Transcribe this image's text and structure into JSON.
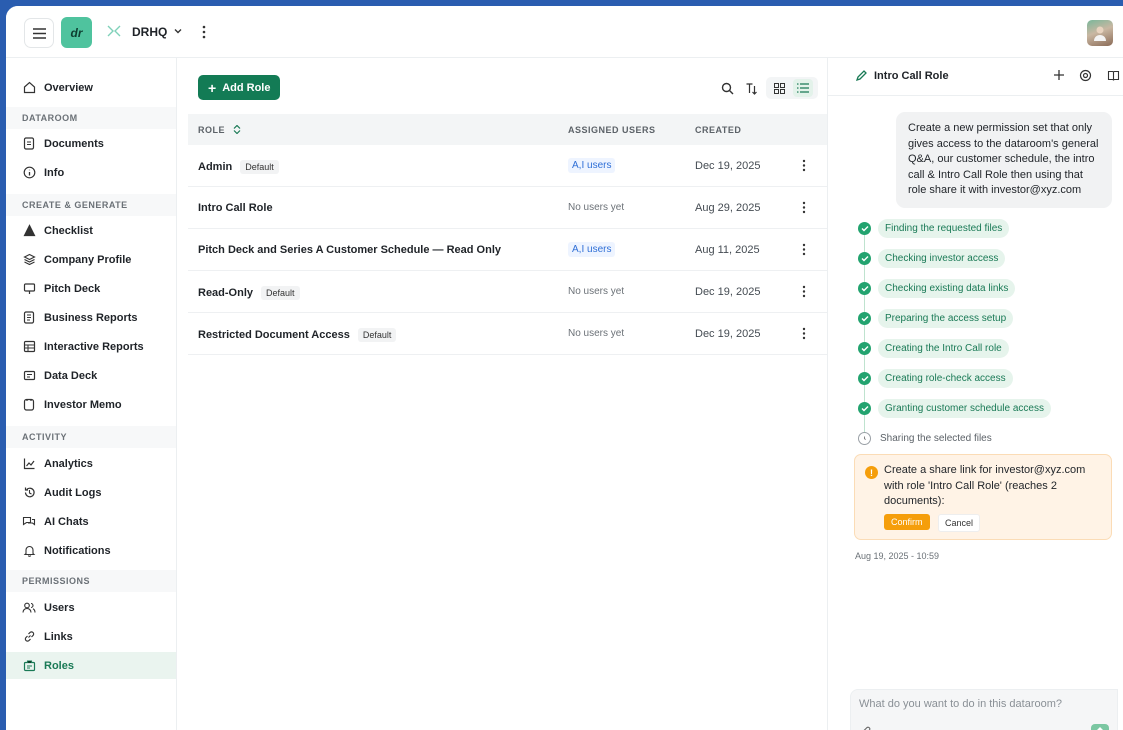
{
  "org": {
    "logo_text": "dr",
    "name": "DRHQ"
  },
  "sidebar": {
    "overview": "Overview",
    "sections": {
      "dataroom": "DATAROOM",
      "create": "CREATE & GENERATE",
      "activity": "ACTIVITY",
      "permissions": "PERMISSIONS"
    },
    "items": {
      "documents": "Documents",
      "info": "Info",
      "checklist": "Checklist",
      "company_profile": "Company Profile",
      "pitch_deck": "Pitch Deck",
      "business_reports": "Business Reports",
      "interactive_reports": "Interactive Reports",
      "data_deck": "Data Deck",
      "investor_memo": "Investor Memo",
      "analytics": "Analytics",
      "audit_logs": "Audit Logs",
      "ai_chats": "AI Chats",
      "notifications": "Notifications",
      "users": "Users",
      "links": "Links",
      "roles": "Roles"
    },
    "active": "roles"
  },
  "main": {
    "add_role_label": "Add Role",
    "columns": {
      "role": "ROLE",
      "assigned_users": "ASSIGNED USERS",
      "created": "CREATED"
    },
    "rows": [
      {
        "name": "Admin",
        "badge": "Default",
        "users": "A,I users",
        "users_pill": true,
        "created": "Dec 19, 2025"
      },
      {
        "name": "Intro Call Role",
        "badge": "",
        "users": "No users yet",
        "users_pill": false,
        "created": "Aug 29, 2025"
      },
      {
        "name": "Pitch Deck and Series A Customer Schedule — Read Only",
        "badge": "",
        "users": "A,I users",
        "users_pill": true,
        "created": "Aug 11, 2025"
      },
      {
        "name": "Read-Only",
        "badge": "Default",
        "users": "No users yet",
        "users_pill": false,
        "created": "Dec 19, 2025"
      },
      {
        "name": "Restricted Document Access",
        "badge": "Default",
        "users": "No users yet",
        "users_pill": false,
        "created": "Dec 19, 2025"
      }
    ]
  },
  "chat": {
    "title": "Intro Call Role",
    "user_message": "Create a new permission set that only gives access to the dataroom's general Q&A, our customer schedule, the intro call & Intro Call Role then using that role share it with investor@xyz.com",
    "steps": [
      {
        "label": "Finding the requested files",
        "done": true
      },
      {
        "label": "Checking investor access",
        "done": true
      },
      {
        "label": "Checking existing data links",
        "done": true
      },
      {
        "label": "Preparing the access setup",
        "done": true
      },
      {
        "label": "Creating the Intro Call role",
        "done": true
      },
      {
        "label": "Creating role-check access",
        "done": true
      },
      {
        "label": "Granting customer schedule access",
        "done": true
      },
      {
        "label": "Sharing the selected files",
        "done": false
      }
    ],
    "confirm_text": "Create a share link for investor@xyz.com with role 'Intro Call Role' (reaches 2 documents):",
    "confirm_label": "Confirm",
    "cancel_label": "Cancel",
    "timestamp": "Aug 19, 2025 - 10:59",
    "input_placeholder": "What do you want to do in this dataroom?"
  },
  "colors": {
    "accent": "#137b55",
    "active_bg": "#eaf4ef",
    "warning": "#f59e0b"
  }
}
